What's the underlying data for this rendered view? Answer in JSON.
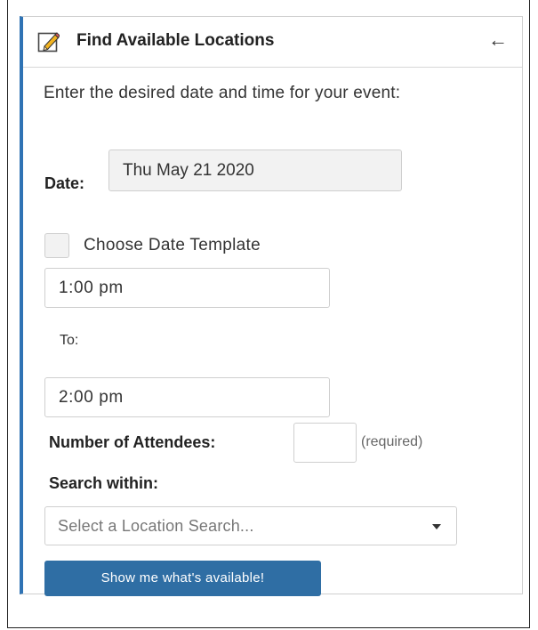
{
  "header": {
    "title": "Find Available Locations",
    "edit_icon": "pencil-icon",
    "back_icon": "left-arrow-icon",
    "back_glyph": "←"
  },
  "instructions": "Enter the desired date and time for your event:",
  "date": {
    "label": "Date:",
    "value": "Thu May 21 2020"
  },
  "date_template": {
    "label": "Choose Date Template",
    "checked": false
  },
  "time": {
    "start": "1:00 pm",
    "to_label": "To:",
    "end": "2:00 pm"
  },
  "attendees": {
    "label": "Number of Attendees:",
    "value": "",
    "required_note": "(required)"
  },
  "search_within": {
    "label": "Search within:",
    "placeholder": "Select a Location Search...",
    "dropdown_icon": "caret-down-icon"
  },
  "submit_label": "Show me what's available!",
  "colors": {
    "accent": "#2f73b4",
    "button": "#2f6ea4",
    "border": "#cfcfcf"
  }
}
